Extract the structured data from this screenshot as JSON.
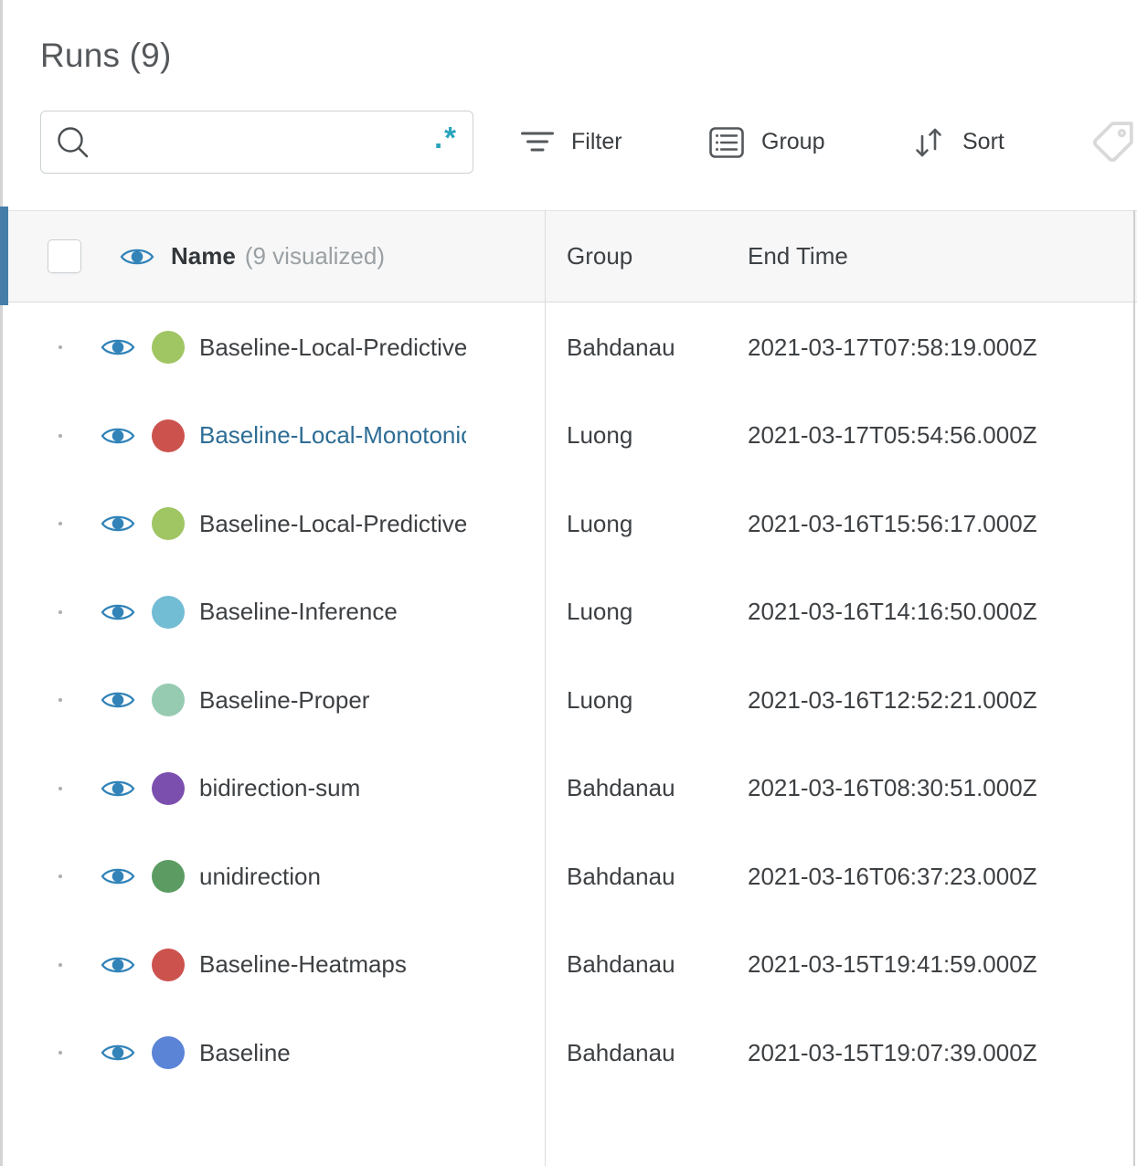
{
  "page": {
    "title": "Runs (9)"
  },
  "toolbar": {
    "search": {
      "value": "",
      "placeholder": "",
      "regex_toggle": ".*"
    },
    "filter_label": "Filter",
    "group_label": "Group",
    "sort_label": "Sort"
  },
  "table": {
    "header": {
      "name": "Name",
      "visualized": "(9 visualized)",
      "group": "Group",
      "end_time": "End Time"
    },
    "rows": [
      {
        "name": "Baseline-Local-Predictive",
        "color": "#a0c563",
        "name_color": "#3d4043",
        "group": "Bahdanau",
        "end_time": "2021-03-17T07:58:19.000Z"
      },
      {
        "name": "Baseline-Local-Monotonic",
        "color": "#cc524e",
        "name_color": "#2e6d95",
        "group": "Luong",
        "end_time": "2021-03-17T05:54:56.000Z"
      },
      {
        "name": "Baseline-Local-Predictive",
        "color": "#a0c563",
        "name_color": "#3d4043",
        "group": "Luong",
        "end_time": "2021-03-16T15:56:17.000Z"
      },
      {
        "name": "Baseline-Inference",
        "color": "#72bcd4",
        "name_color": "#3d4043",
        "group": "Luong",
        "end_time": "2021-03-16T14:16:50.000Z"
      },
      {
        "name": "Baseline-Proper",
        "color": "#96cbb1",
        "name_color": "#3d4043",
        "group": "Luong",
        "end_time": "2021-03-16T12:52:21.000Z"
      },
      {
        "name": "bidirection-sum",
        "color": "#7b4fae",
        "name_color": "#3d4043",
        "group": "Bahdanau",
        "end_time": "2021-03-16T08:30:51.000Z"
      },
      {
        "name": "unidirection",
        "color": "#5c9c63",
        "name_color": "#3d4043",
        "group": "Bahdanau",
        "end_time": "2021-03-16T06:37:23.000Z"
      },
      {
        "name": "Baseline-Heatmaps",
        "color": "#cc524e",
        "name_color": "#3d4043",
        "group": "Bahdanau",
        "end_time": "2021-03-15T19:41:59.000Z"
      },
      {
        "name": "Baseline",
        "color": "#5b83d6",
        "name_color": "#3d4043",
        "group": "Bahdanau",
        "end_time": "2021-03-15T19:07:39.000Z"
      }
    ]
  },
  "colors": {
    "accent_strip": "#447ea8",
    "eye_icon": "#3183b8",
    "link_text": "#2e6d95",
    "regex_icon": "#2aa4bc",
    "header_bg": "#f7f7f8"
  }
}
